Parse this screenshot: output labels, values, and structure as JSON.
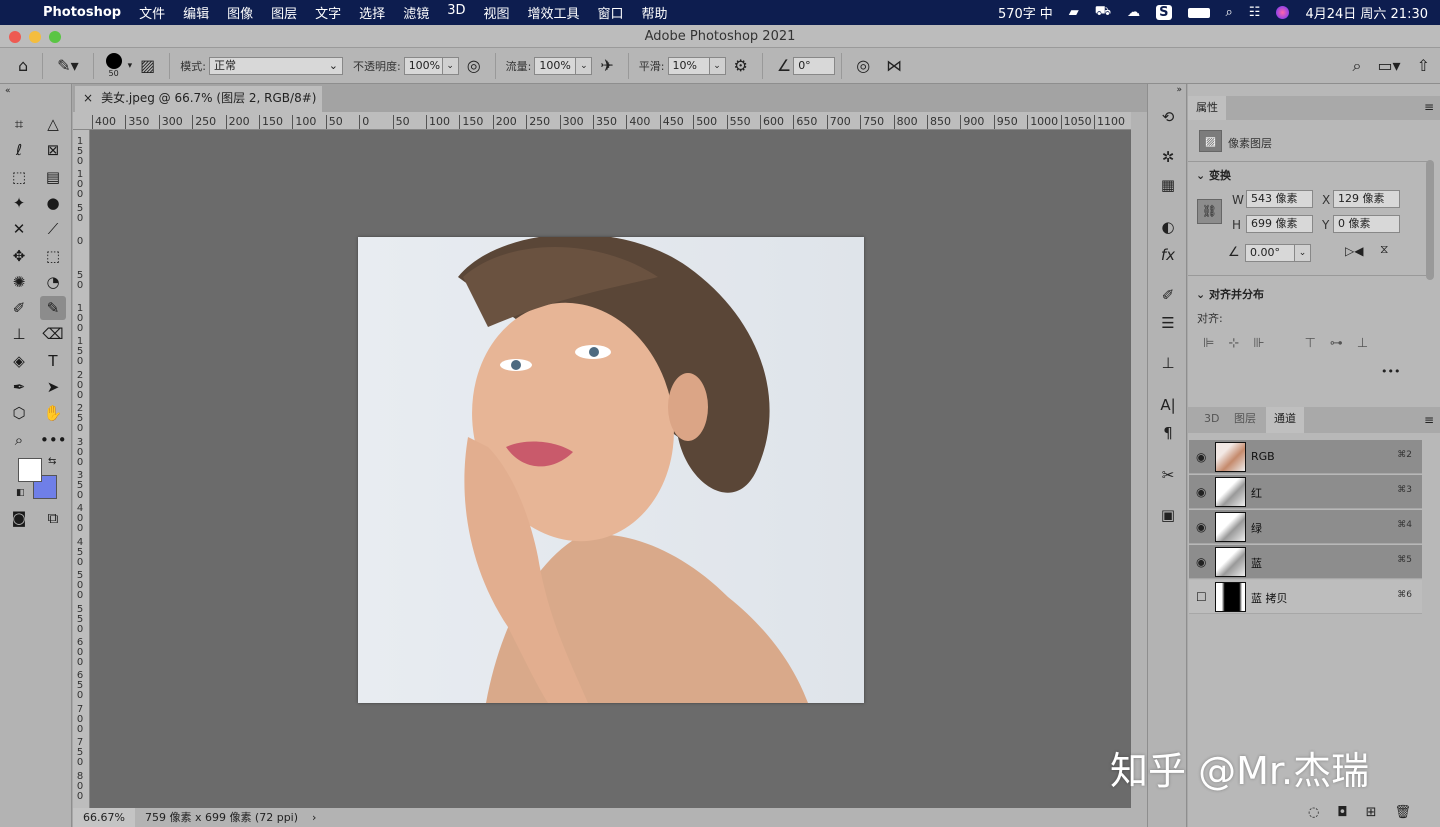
{
  "menubar": {
    "apple": "",
    "app": "Photoshop",
    "items": [
      "文件",
      "编辑",
      "图像",
      "图层",
      "文字",
      "选择",
      "滤镜",
      "3D",
      "视图",
      "增效工具",
      "窗口",
      "帮助"
    ],
    "word_count": "570字",
    "input_method": "中",
    "datetime": "4月24日 周六  21:30"
  },
  "window": {
    "title": "Adobe Photoshop 2021"
  },
  "options": {
    "brush_size": "50",
    "mode_label": "模式:",
    "mode_value": "正常",
    "opacity_label": "不透明度:",
    "opacity_value": "100%",
    "flow_label": "流量:",
    "flow_value": "100%",
    "smooth_label": "平滑:",
    "smooth_value": "10%",
    "angle_value": "0°"
  },
  "document": {
    "tab_title": "美女.jpeg @ 66.7% (图层 2, RGB/8#) *",
    "close": "×"
  },
  "rulers": {
    "top": [
      "400",
      "350",
      "300",
      "250",
      "200",
      "150",
      "100",
      "50",
      "0",
      "50",
      "100",
      "150",
      "200",
      "250",
      "300",
      "350",
      "400",
      "450",
      "500",
      "550",
      "600",
      "650",
      "700",
      "750",
      "800",
      "850",
      "900",
      "950",
      "1000",
      "1050",
      "1100"
    ],
    "left": [
      "150",
      "100",
      "50",
      "0",
      "50",
      "100",
      "150",
      "200",
      "250",
      "300",
      "350",
      "400",
      "450",
      "500",
      "550",
      "600",
      "650",
      "700",
      "750",
      "800"
    ]
  },
  "status": {
    "zoom": "66.67%",
    "doc_info": "759 像素 x 699 像素 (72 ppi)",
    "arrow": "›"
  },
  "colors": {
    "foreground": "#ffffff",
    "background": "#6f7fe8",
    "accent_menubar": "#0d1d4f"
  },
  "properties": {
    "tab": "属性",
    "layer_type": "像素图层",
    "transform_title": "变换",
    "w_label": "W",
    "w_value": "543 像素",
    "x_label": "X",
    "x_value": "129 像素",
    "h_label": "H",
    "h_value": "699 像素",
    "y_label": "Y",
    "y_value": "0 像素",
    "angle_value": "0.00°",
    "align_title": "对齐并分布",
    "align_label": "对齐:",
    "more": "•••"
  },
  "channels": {
    "tabs": [
      "3D",
      "图层",
      "通道"
    ],
    "active_tab": "通道",
    "rows": [
      {
        "name": "RGB",
        "key": "⌘2",
        "visible": true
      },
      {
        "name": "红",
        "key": "⌘3",
        "visible": true
      },
      {
        "name": "绿",
        "key": "⌘4",
        "visible": true
      },
      {
        "name": "蓝",
        "key": "⌘5",
        "visible": true
      },
      {
        "name": "蓝 拷贝",
        "key": "⌘6",
        "visible": false
      }
    ]
  },
  "watermark": "知乎 @Mr.杰瑞"
}
